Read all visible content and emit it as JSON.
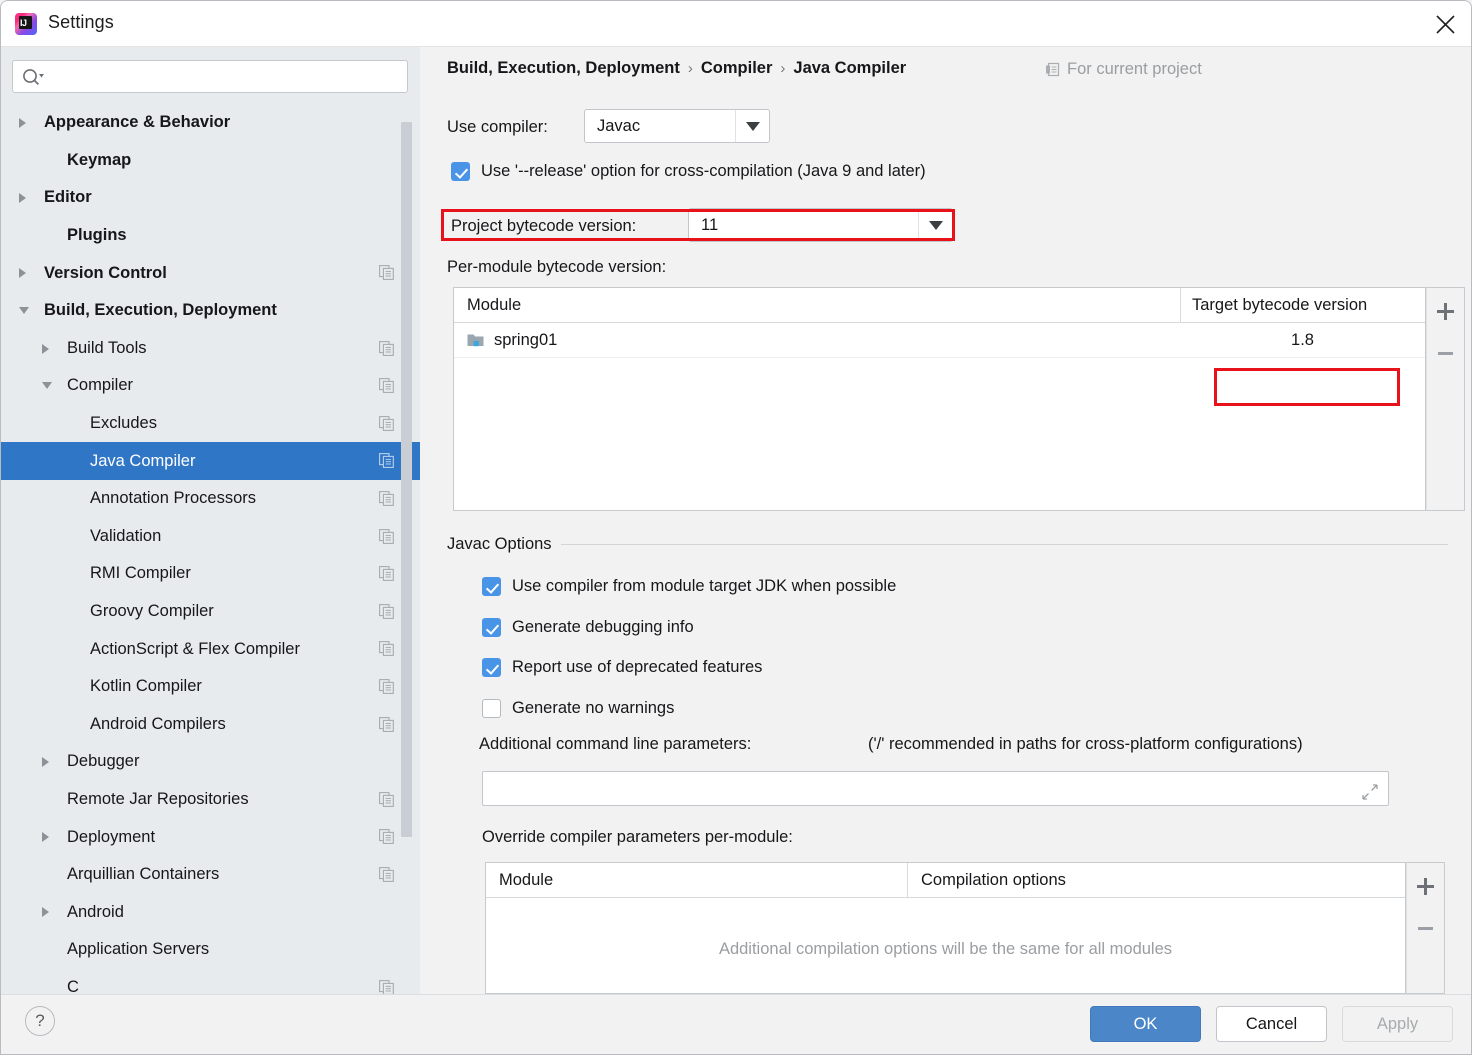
{
  "window": {
    "title": "Settings",
    "logo_text": "IJ",
    "close_icon": "close-icon"
  },
  "sidebar": {
    "search": {
      "value": "",
      "placeholder": ""
    },
    "items": [
      {
        "label": "Appearance & Behavior",
        "twisty": "right",
        "bold": true,
        "indent": 22,
        "badge": false,
        "selected": false
      },
      {
        "label": "Keymap",
        "twisty": "none",
        "bold": true,
        "indent": 45,
        "badge": false,
        "selected": false
      },
      {
        "label": "Editor",
        "twisty": "right",
        "bold": true,
        "indent": 22,
        "badge": false,
        "selected": false
      },
      {
        "label": "Plugins",
        "twisty": "none",
        "bold": true,
        "indent": 45,
        "badge": false,
        "selected": false
      },
      {
        "label": "Version Control",
        "twisty": "right",
        "bold": true,
        "indent": 22,
        "badge": true,
        "selected": false
      },
      {
        "label": "Build, Execution, Deployment",
        "twisty": "down",
        "bold": true,
        "indent": 22,
        "badge": false,
        "selected": false
      },
      {
        "label": "Build Tools",
        "twisty": "right",
        "bold": false,
        "indent": 45,
        "badge": true,
        "selected": false
      },
      {
        "label": "Compiler",
        "twisty": "down",
        "bold": false,
        "indent": 45,
        "badge": true,
        "selected": false
      },
      {
        "label": "Excludes",
        "twisty": "none",
        "bold": false,
        "indent": 68,
        "badge": true,
        "selected": false
      },
      {
        "label": "Java Compiler",
        "twisty": "none",
        "bold": false,
        "indent": 68,
        "badge": true,
        "selected": true
      },
      {
        "label": "Annotation Processors",
        "twisty": "none",
        "bold": false,
        "indent": 68,
        "badge": true,
        "selected": false
      },
      {
        "label": "Validation",
        "twisty": "none",
        "bold": false,
        "indent": 68,
        "badge": true,
        "selected": false
      },
      {
        "label": "RMI Compiler",
        "twisty": "none",
        "bold": false,
        "indent": 68,
        "badge": true,
        "selected": false
      },
      {
        "label": "Groovy Compiler",
        "twisty": "none",
        "bold": false,
        "indent": 68,
        "badge": true,
        "selected": false
      },
      {
        "label": "ActionScript & Flex Compiler",
        "twisty": "none",
        "bold": false,
        "indent": 68,
        "badge": true,
        "selected": false
      },
      {
        "label": "Kotlin Compiler",
        "twisty": "none",
        "bold": false,
        "indent": 68,
        "badge": true,
        "selected": false
      },
      {
        "label": "Android Compilers",
        "twisty": "none",
        "bold": false,
        "indent": 68,
        "badge": true,
        "selected": false
      },
      {
        "label": "Debugger",
        "twisty": "right",
        "bold": false,
        "indent": 45,
        "badge": false,
        "selected": false
      },
      {
        "label": "Remote Jar Repositories",
        "twisty": "none",
        "bold": false,
        "indent": 45,
        "badge": true,
        "selected": false
      },
      {
        "label": "Deployment",
        "twisty": "right",
        "bold": false,
        "indent": 45,
        "badge": true,
        "selected": false
      },
      {
        "label": "Arquillian Containers",
        "twisty": "none",
        "bold": false,
        "indent": 45,
        "badge": true,
        "selected": false
      },
      {
        "label": "Android",
        "twisty": "right",
        "bold": false,
        "indent": 45,
        "badge": false,
        "selected": false
      },
      {
        "label": "Application Servers",
        "twisty": "none",
        "bold": false,
        "indent": 45,
        "badge": false,
        "selected": false
      },
      {
        "label": "C",
        "twisty": "none",
        "bold": false,
        "indent": 45,
        "badge": true,
        "selected": false
      }
    ]
  },
  "breadcrumb": {
    "part1": "Build, Execution, Deployment",
    "sep1": "›",
    "part2": "Compiler",
    "sep2": "›",
    "part3": "Java Compiler",
    "scope_label": "For current project"
  },
  "compiler": {
    "use_compiler_label": "Use compiler:",
    "use_compiler_value": "Javac",
    "release_option_label": "Use '--release' option for cross-compilation (Java 9 and later)",
    "release_option_checked": true,
    "project_bytecode_label": "Project bytecode version:",
    "project_bytecode_value": "11",
    "per_module_label": "Per-module bytecode version:"
  },
  "module_table": {
    "columns": [
      "Module",
      "Target bytecode version"
    ],
    "rows": [
      {
        "module": "spring01",
        "target": "1.8"
      }
    ],
    "add_icon": "plus-icon",
    "remove_icon": "minus-icon"
  },
  "javac": {
    "group_title": "Javac Options",
    "options": [
      {
        "label": "Use compiler from module target JDK when possible",
        "checked": true
      },
      {
        "label": "Generate debugging info",
        "checked": true
      },
      {
        "label": "Report use of deprecated features",
        "checked": true
      },
      {
        "label": "Generate no warnings",
        "checked": false
      }
    ],
    "additional_params_label": "Additional command line parameters:",
    "additional_params_hint": "('/' recommended in paths for cross-platform configurations)",
    "additional_params_value": "",
    "expand_icon": "expand-icon"
  },
  "override_table": {
    "title": "Override compiler parameters per-module:",
    "columns": [
      "Module",
      "Compilation options"
    ],
    "empty_message": "Additional compilation options will be the same for all modules",
    "add_icon": "plus-icon",
    "remove_icon": "minus-icon"
  },
  "footer": {
    "help_label": "?",
    "ok_label": "OK",
    "cancel_label": "Cancel",
    "apply_label": "Apply"
  },
  "colors": {
    "selection_blue": "#2f76c7",
    "accent_blue": "#4a94e8",
    "annotation_red": "#e8121a",
    "sidebar_bg": "#e7ebee",
    "panel_bg": "#f2f2f2"
  }
}
